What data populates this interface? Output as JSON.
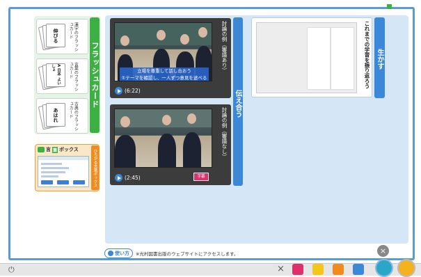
{
  "flashcard": {
    "tab_label": "フラッシュカード",
    "cards": [
      {
        "card_word": "伸びる",
        "label": "漢字のフラッシュカード"
      },
      {
        "card_word": "A 日本 よいしょ",
        "label": "言葉のフラッシュカード"
      },
      {
        "card_word": "あはれ",
        "label": "古典のフラッシュカード"
      }
    ]
  },
  "gokan_box": {
    "title_prefix": "言",
    "title_box": "葉",
    "title_suffix": "ボックス",
    "side_label": "ひろがる言葉ボックス"
  },
  "tsutaeau": {
    "tab_label": "伝え合う",
    "videos": [
      {
        "title": "討論の例（審議あり）",
        "caption_line1": "立場を尊重して話し合おう",
        "caption_line2": "①テーマを確認し、一人ずつ意見を述べる",
        "duration": "(6:22)",
        "has_jimaku": false
      },
      {
        "title": "討論の例（審議なし）",
        "caption_line1": "",
        "caption_line2": "",
        "duration": "(2:45)",
        "has_jimaku": true,
        "jimaku_label": "字幕"
      }
    ]
  },
  "ikasu": {
    "tab_label": "生かす",
    "card_title": "これまでの学習を振り返ろう"
  },
  "footer": {
    "usage_label": "使い方",
    "usage_note": "※光村図書出版のウェブサイトにアクセスします。",
    "close_symbol": "×"
  },
  "taskbar": {
    "power_symbol": "⏻",
    "close_symbol": "×"
  },
  "colors": {
    "frame": "#5b9bd5",
    "flashcard_accent": "#3cb043",
    "tsutae_accent": "#3b87d8",
    "gokan_accent": "#f08c1e"
  }
}
